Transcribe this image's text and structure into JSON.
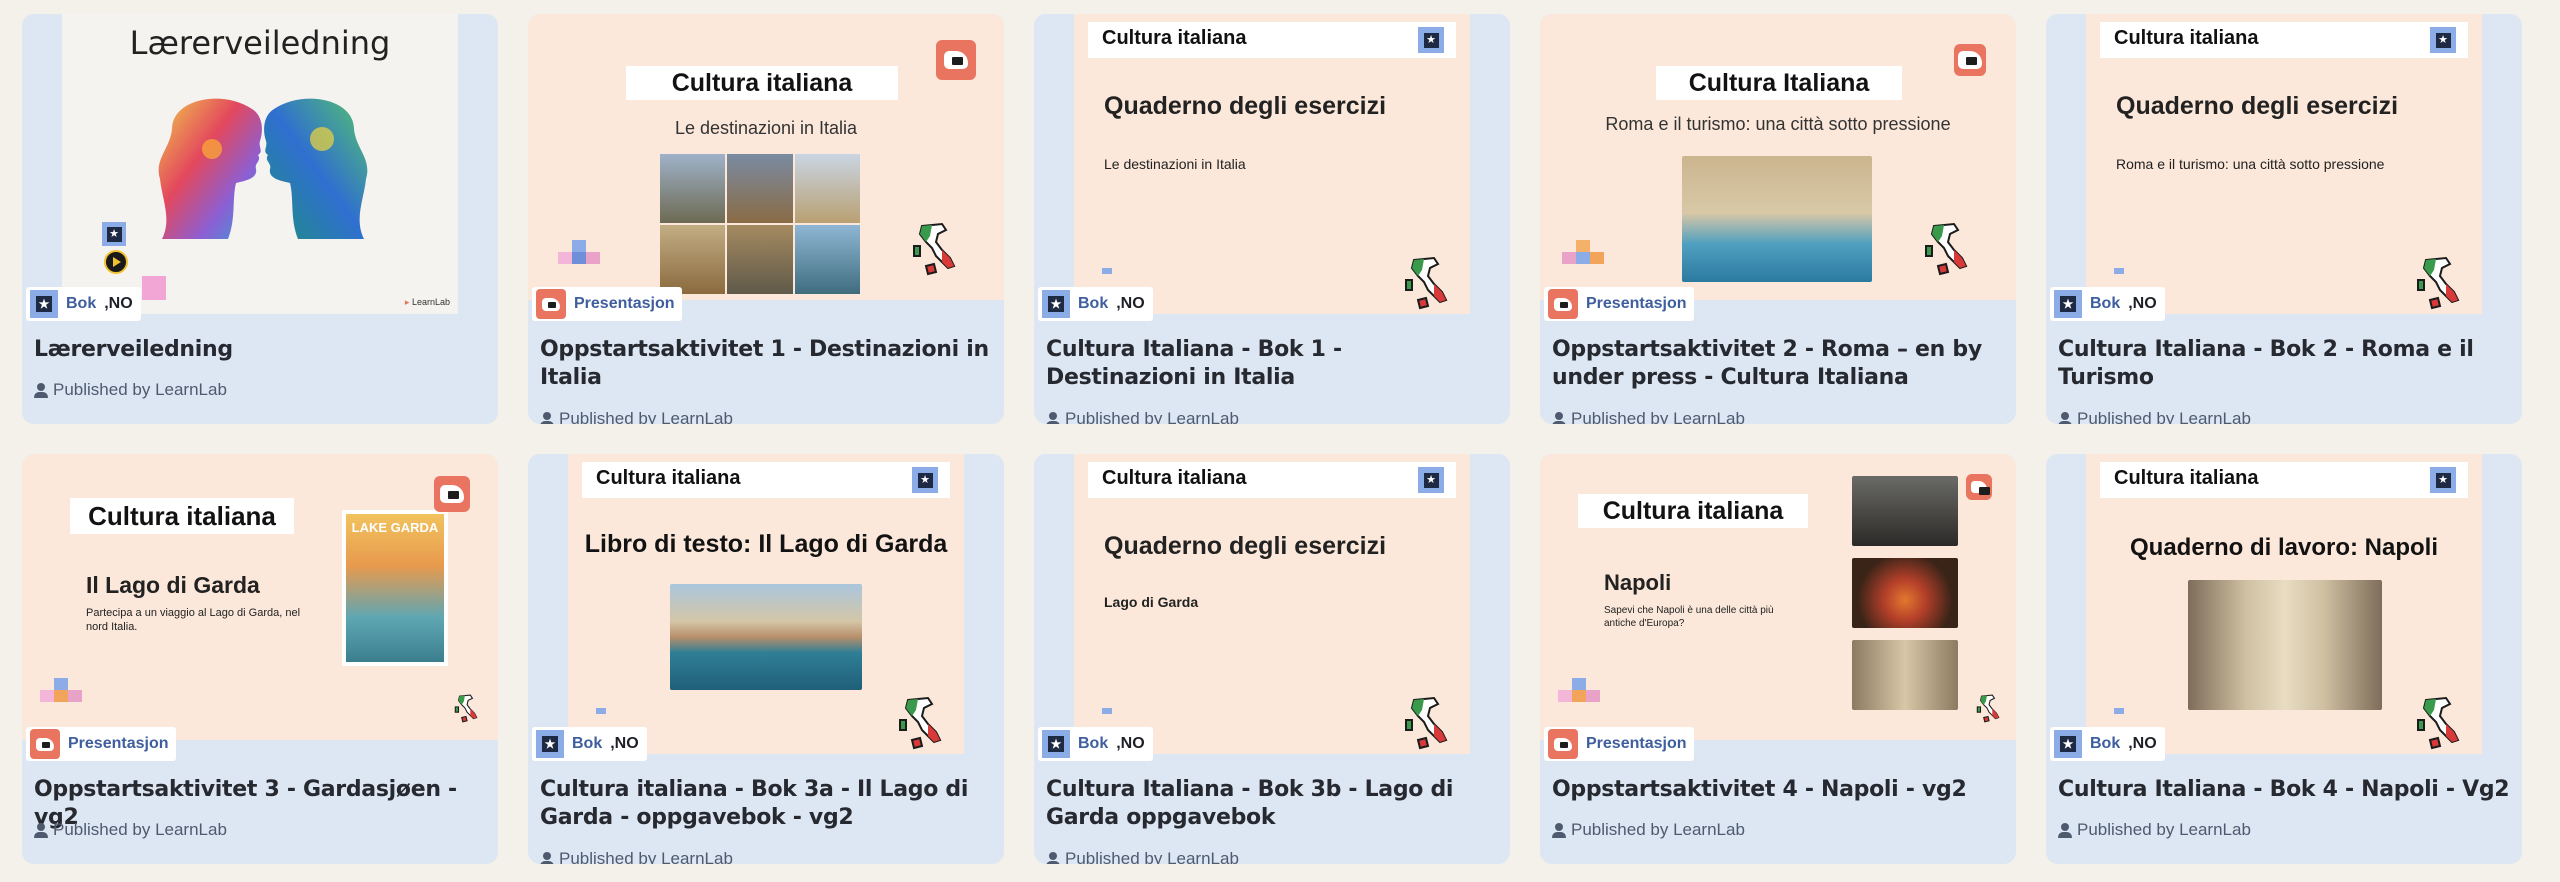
{
  "colors": {
    "page_bg": "#f4f1ea",
    "card_bg": "#dde6f3",
    "slide_bg": "#fbe8da",
    "accent_blue": "#3f5e9e",
    "presentation_red": "#e9745f",
    "book_icon": "#8bace7"
  },
  "publisher_text": "Published by LearnLab",
  "cards": [
    {
      "title": "Lærerveiledning",
      "type": "Bok",
      "lang": ",NO",
      "slide": {
        "heading": "Lærerveiledning",
        "footer": "LearnLab"
      },
      "icon": "book-icon"
    },
    {
      "title": "Oppstartsaktivitet 1 - Destinazioni in Italia",
      "type": "Presentasjon",
      "slide": {
        "heading": "Cultura italiana",
        "subheading": "Le destinazioni in Italia"
      },
      "icon": "presentation-icon"
    },
    {
      "title": "Cultura Italiana - Bok 1 - Destinazioni in Italia",
      "type": "Bok",
      "lang": ",NO",
      "slide": {
        "bar": "Cultura italiana",
        "heading": "Quaderno degli esercizi",
        "text": "Le destinazioni in Italia"
      },
      "icon": "book-icon"
    },
    {
      "title": "Oppstartsaktivitet 2 - Roma – en by under press - Cultura Italiana",
      "type": "Presentasjon",
      "slide": {
        "heading": "Cultura Italiana",
        "subheading": "Roma e il turismo: una città sotto pressione"
      },
      "icon": "presentation-icon"
    },
    {
      "title": "Cultura Italiana - Bok 2 - Roma e il Turismo",
      "type": "Bok",
      "lang": ",NO",
      "slide": {
        "bar": "Cultura italiana",
        "heading": "Quaderno degli esercizi",
        "text": "Roma e il turismo: una città sotto pressione"
      },
      "icon": "book-icon"
    },
    {
      "title": "Oppstartsaktivitet 3 - Gardasjøen - vg2",
      "type": "Presentasjon",
      "slide": {
        "heading": "Cultura italiana",
        "subheading": "Il Lago di Garda",
        "text": "Partecipa a un viaggio al Lago di Garda, nel nord Italia.",
        "poster": "LAKE GARDA"
      },
      "icon": "presentation-icon"
    },
    {
      "title": "Cultura italiana - Bok 3a - Il Lago di Garda - oppgavebok - vg2",
      "type": "Bok",
      "lang": ",NO",
      "slide": {
        "bar": "Cultura italiana",
        "heading": "Libro di testo: Il Lago di Garda"
      },
      "icon": "book-icon"
    },
    {
      "title": "Cultura Italiana - Bok 3b - Lago di Garda oppgavebok",
      "type": "Bok",
      "lang": ",NO",
      "slide": {
        "bar": "Cultura italiana",
        "heading": "Quaderno degli esercizi",
        "text": "Lago di Garda"
      },
      "icon": "book-icon"
    },
    {
      "title": "Oppstartsaktivitet 4 - Napoli - vg2",
      "type": "Presentasjon",
      "slide": {
        "heading": "Cultura italiana",
        "subheading": "Napoli",
        "text": "Sapevi che Napoli è una delle città più antiche d'Europa?"
      },
      "icon": "presentation-icon"
    },
    {
      "title": "Cultura Italiana - Bok 4 - Napoli - Vg2",
      "type": "Bok",
      "lang": ",NO",
      "slide": {
        "bar": "Cultura italiana",
        "heading": "Quaderno di lavoro: Napoli"
      },
      "icon": "book-icon"
    }
  ]
}
